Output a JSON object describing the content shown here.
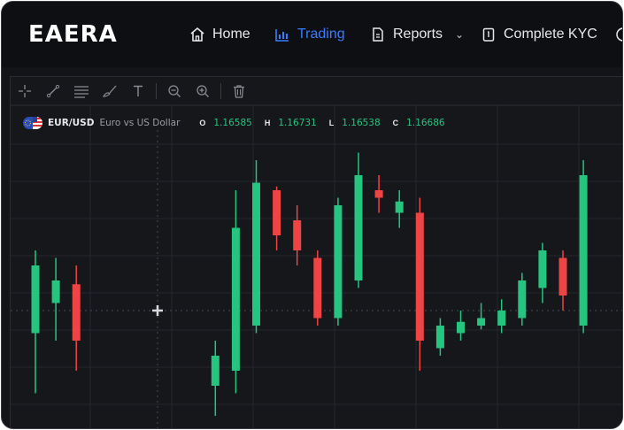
{
  "brand": {
    "logo_text": "EAERA"
  },
  "nav": [
    {
      "label": "Home",
      "icon": "home-icon",
      "active": false
    },
    {
      "label": "Trading",
      "icon": "bar-chart-icon",
      "active": true
    },
    {
      "label": "Reports",
      "icon": "document-icon",
      "active": false,
      "has_dropdown": true
    },
    {
      "label": "Complete KYC",
      "icon": "clipboard-icon",
      "active": false
    }
  ],
  "toolbar": {
    "tools": [
      "crosshair-icon",
      "trend-line-icon",
      "fib-lines-icon",
      "brush-icon",
      "text-icon",
      "zoom-out-icon",
      "zoom-in-icon",
      "trash-icon"
    ]
  },
  "instrument": {
    "symbol": "EUR/USD",
    "description": "Euro vs US Dollar",
    "ohlc": {
      "o_label": "O",
      "o": "1.16585",
      "h_label": "H",
      "h": "1.16731",
      "l_label": "L",
      "l": "1.16538",
      "c_label": "C",
      "c": "1.16686"
    }
  },
  "colors": {
    "accent": "#3a7bff",
    "up": "#26c57f",
    "down": "#ef4444",
    "bg": "#16171b"
  },
  "chart_data": {
    "type": "candlestick",
    "candles": [
      {
        "o": 1.1643,
        "h": 1.1654,
        "l": 1.1635,
        "c": 1.1652
      },
      {
        "o": 1.1647,
        "h": 1.1653,
        "l": 1.1642,
        "c": 1.165
      },
      {
        "o": 1.16495,
        "h": 1.1652,
        "l": 1.1638,
        "c": 1.1642
      },
      {
        "o": 1.1636,
        "h": 1.1642,
        "l": 1.1632,
        "c": 1.164
      },
      {
        "o": 1.1638,
        "h": 1.1662,
        "l": 1.1635,
        "c": 1.1657
      },
      {
        "o": 1.1644,
        "h": 1.1666,
        "l": 1.1643,
        "c": 1.1663
      },
      {
        "o": 1.1662,
        "h": 1.16625,
        "l": 1.1654,
        "c": 1.1656
      },
      {
        "o": 1.1658,
        "h": 1.166,
        "l": 1.1652,
        "c": 1.1654
      },
      {
        "o": 1.1653,
        "h": 1.1654,
        "l": 1.1644,
        "c": 1.1645
      },
      {
        "o": 1.1645,
        "h": 1.1661,
        "l": 1.1644,
        "c": 1.166
      },
      {
        "o": 1.165,
        "h": 1.1667,
        "l": 1.1649,
        "c": 1.1664
      },
      {
        "o": 1.1662,
        "h": 1.1664,
        "l": 1.1659,
        "c": 1.1661
      },
      {
        "o": 1.1659,
        "h": 1.1662,
        "l": 1.1657,
        "c": 1.16605
      },
      {
        "o": 1.1659,
        "h": 1.1661,
        "l": 1.1638,
        "c": 1.1642
      },
      {
        "o": 1.1641,
        "h": 1.1645,
        "l": 1.164,
        "c": 1.1644
      },
      {
        "o": 1.1643,
        "h": 1.1646,
        "l": 1.1642,
        "c": 1.16445
      },
      {
        "o": 1.1644,
        "h": 1.1647,
        "l": 1.16435,
        "c": 1.1645
      },
      {
        "o": 1.1644,
        "h": 1.16475,
        "l": 1.1643,
        "c": 1.1646
      },
      {
        "o": 1.1645,
        "h": 1.1651,
        "l": 1.1644,
        "c": 1.165
      },
      {
        "o": 1.1649,
        "h": 1.1655,
        "l": 1.1647,
        "c": 1.1654
      },
      {
        "o": 1.1653,
        "h": 1.1654,
        "l": 1.1646,
        "c": 1.1648
      },
      {
        "o": 1.1644,
        "h": 1.1666,
        "l": 1.1643,
        "c": 1.1664
      }
    ],
    "ylim": [
      1.163,
      1.167
    ],
    "grid": true,
    "crosshair_price": 1.1646
  }
}
